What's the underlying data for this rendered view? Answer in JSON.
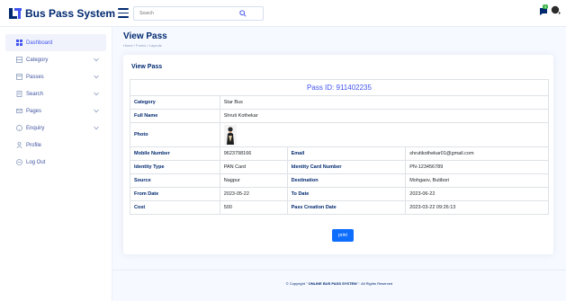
{
  "header": {
    "app_name": "Bus Pass System",
    "search_placeholder": "Search",
    "notification_count": "3"
  },
  "sidebar": {
    "items": [
      {
        "label": "Dashboard",
        "active": true,
        "has_chevron": false
      },
      {
        "label": "Category",
        "active": false,
        "has_chevron": true
      },
      {
        "label": "Passes",
        "active": false,
        "has_chevron": true
      },
      {
        "label": "Search",
        "active": false,
        "has_chevron": true
      },
      {
        "label": "Pages",
        "active": false,
        "has_chevron": true
      },
      {
        "label": "Enquiry",
        "active": false,
        "has_chevron": true
      },
      {
        "label": "Profile",
        "active": false,
        "has_chevron": false
      },
      {
        "label": "Log Out",
        "active": false,
        "has_chevron": false
      }
    ]
  },
  "page": {
    "title": "View Pass",
    "breadcrumb": "Home / Forms / Layouts"
  },
  "card": {
    "title": "View Pass",
    "pass_id": "Pass ID: 911402235",
    "fields": {
      "category_label": "Category",
      "category_value": "Star Bus",
      "full_name_label": "Full Name",
      "full_name_value": "Shruti Kothekar",
      "photo_label": "Photo",
      "mobile_label": "Mobile Number",
      "mobile_value": "9623798166",
      "email_label": "Email",
      "email_value": "shrutikothekar01@gmail.com",
      "identity_type_label": "Identity Type",
      "identity_type_value": "PAN Card",
      "identity_number_label": "Identity Card Number",
      "identity_number_value": "PN-123456789",
      "source_label": "Source",
      "source_value": "Nagpur",
      "destination_label": "Destination",
      "destination_value": "Mohgaov, Butibori",
      "from_date_label": "From Date",
      "from_date_value": "2023-05-22",
      "to_date_label": "To Date",
      "to_date_value": "2023-06-22",
      "cost_label": "Cost",
      "cost_value": "500",
      "creation_date_label": "Pass Creation Date",
      "creation_date_value": "2023-03-22 09:26:13"
    },
    "print_label": "print"
  },
  "footer": {
    "prefix": "© Copyright \"",
    "brand": " ONLINE BUS PASS SYSTEM ",
    "suffix": "\". All Rights Reserved"
  },
  "colors": {
    "primary": "#4154f1",
    "navy": "#012970",
    "button": "#0d6efd"
  }
}
